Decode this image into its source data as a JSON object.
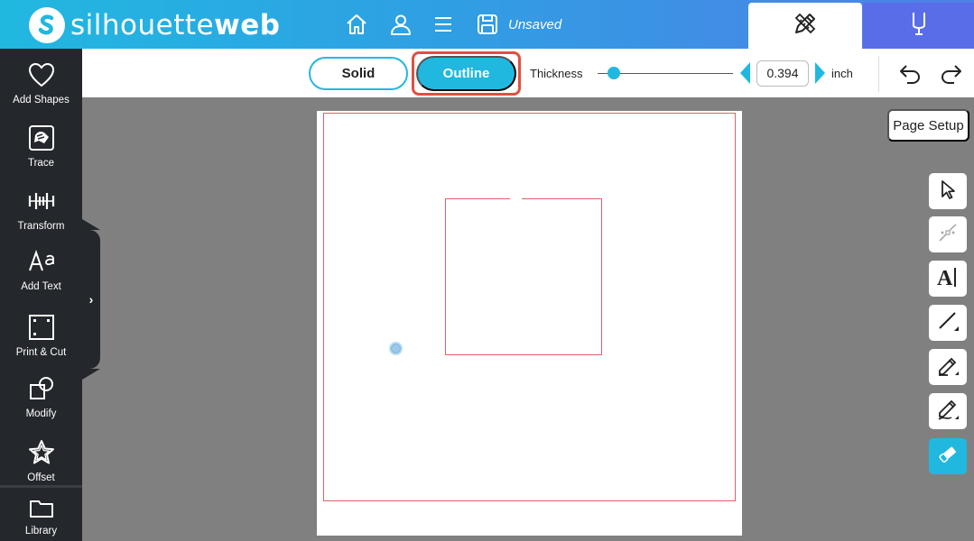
{
  "header": {
    "logo_text_light": "silhouette",
    "logo_text_bold": "web",
    "status": "Unsaved",
    "icons": [
      "home-icon",
      "user-icon",
      "menu-icon",
      "save-icon"
    ],
    "tabs": [
      {
        "name": "design",
        "icon": "pencil-ruler-icon",
        "active": true
      },
      {
        "name": "cut",
        "icon": "blade-icon",
        "active": false
      }
    ]
  },
  "sidebar": {
    "items": [
      {
        "label": "Add Shapes",
        "icon": "heart-icon"
      },
      {
        "label": "Trace",
        "icon": "trace-icon"
      },
      {
        "label": "Transform",
        "icon": "transform-icon"
      },
      {
        "label": "Add Text",
        "icon": "text-icon"
      },
      {
        "label": "Print & Cut",
        "icon": "print-cut-icon"
      },
      {
        "label": "Modify",
        "icon": "modify-icon"
      },
      {
        "label": "Offset",
        "icon": "star-icon"
      },
      {
        "label": "Library",
        "icon": "folder-icon"
      }
    ],
    "expand_glyph": "›"
  },
  "toolbar": {
    "solid_label": "Solid",
    "outline_label": "Outline",
    "selected_mode": "Outline",
    "thickness_label": "Thickness",
    "thickness_value": "0.394",
    "unit": "inch"
  },
  "right_panel": {
    "page_setup_label": "Page Setup",
    "tools": [
      "select-icon",
      "edit-points-icon",
      "text-cursor-icon",
      "line-icon",
      "pen-icon",
      "pencil-icon",
      "eraser-icon"
    ],
    "active_tool": "eraser-icon"
  },
  "colors": {
    "accent": "#21b8e0",
    "sidebar_bg": "#24272b",
    "cut_line": "#e0606a",
    "highlight": "#e05040",
    "workspace": "#808080"
  }
}
